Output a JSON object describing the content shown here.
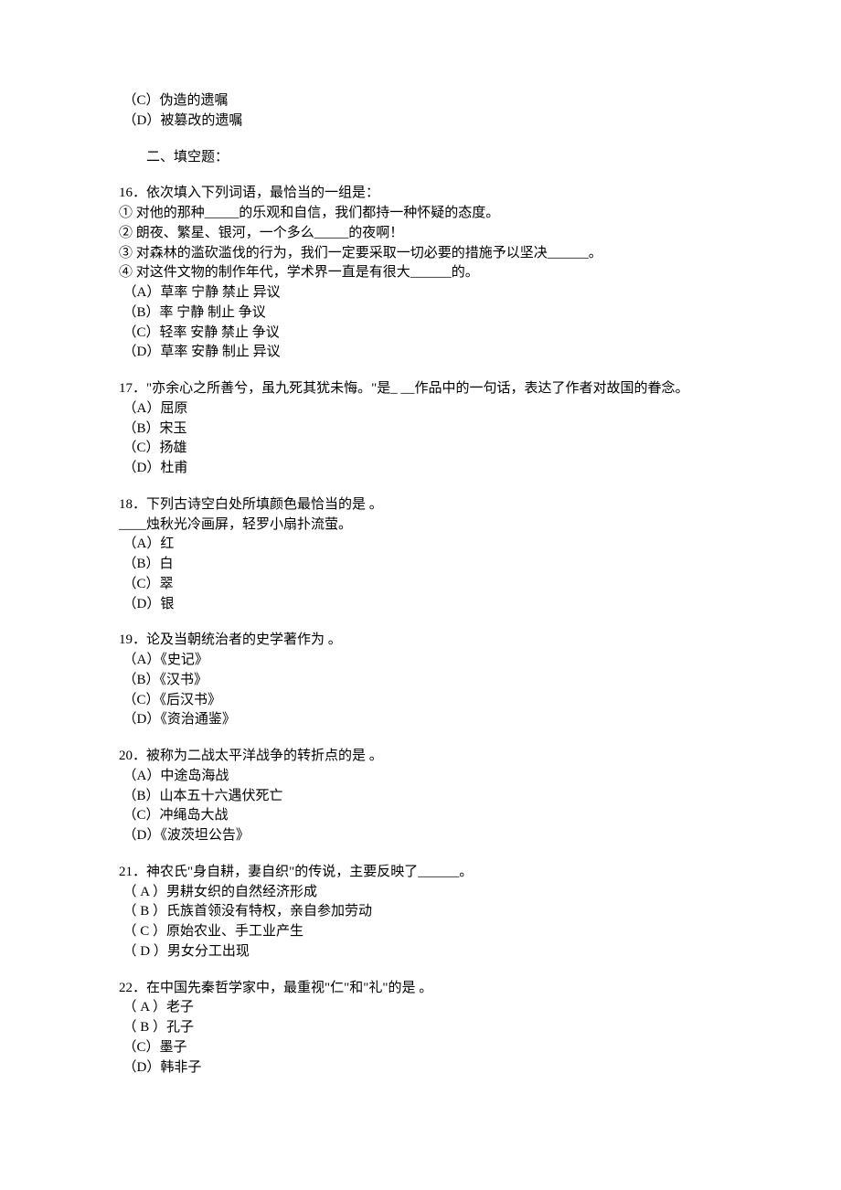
{
  "precontext": {
    "c": "（C）伪造的遗嘱",
    "d": "（D）被篡改的遗嘱"
  },
  "section": "二、填空题：",
  "q16": {
    "stem": "16．依次填入下列词语，最恰当的一组是：",
    "s1": "① 对他的那种_____的乐观和自信，我们都持一种怀疑的态度。",
    "s2": "② 朗夜、繁星、银河，一个多么_____的夜啊！",
    "s3": "③ 对森林的滥砍滥伐的行为，我们一定要采取一切必要的措施予以坚决______。",
    "s4": "④ 对这件文物的制作年代，学术界一直是有很大______的。",
    "a": "（A）草率 宁静   禁止 异议",
    "b": "（B）率 宁静 制止 争议",
    "c": "（C）轻率 安静 禁止 争议",
    "d": "（D）草率 安静 制止 异议"
  },
  "q17": {
    "stem": "17．\"亦余心之所善兮，虽九死其犹未悔。\"是_   __作品中的一句话，表达了作者对故国的眷念。",
    "a": "（A）屈原",
    "b": "（B）宋玉",
    "c": "（C）扬雄",
    "d": "（D）杜甫"
  },
  "q18": {
    "stem": "18．下列古诗空白处所填颜色最恰当的是          。",
    "s1": "____烛秋光冷画屏，轻罗小扇扑流萤。",
    "a": "（A）红",
    "b": "（B）白",
    "c": "（C）翠",
    "d": "（D）银"
  },
  "q19": {
    "stem": "19．论及当朝统治者的史学著作为         。",
    "a": "（A）《史记》",
    "b": "（B）《汉书》",
    "c": "（C）《后汉书》",
    "d": "（D）《资治通鉴》"
  },
  "q20": {
    "stem": "20．被称为二战太平洋战争的转折点的是       。",
    "a": "（A）中途岛海战",
    "b": "（B）山本五十六遇伏死亡",
    "c": "（C）冲绳岛大战",
    "d": "（D）《波茨坦公告》"
  },
  "q21": {
    "stem": "21．神农氏\"身自耕，妻自织\"的传说，主要反映了______。",
    "a": "（ A ）男耕女织的自然经济形成",
    "b": "（ B ）氏族首领没有特权，亲自参加劳动",
    "c": "（ C ）原始农业、手工业产生",
    "d": "（ D ）男女分工出现"
  },
  "q22": {
    "stem": "22．在中国先秦哲学家中，最重视\"仁\"和\"礼\"的是           。",
    "a": "（ A ）老子",
    "b": "（ B ）孔子",
    "c": "（C）墨子",
    "d": "（D）韩非子"
  }
}
